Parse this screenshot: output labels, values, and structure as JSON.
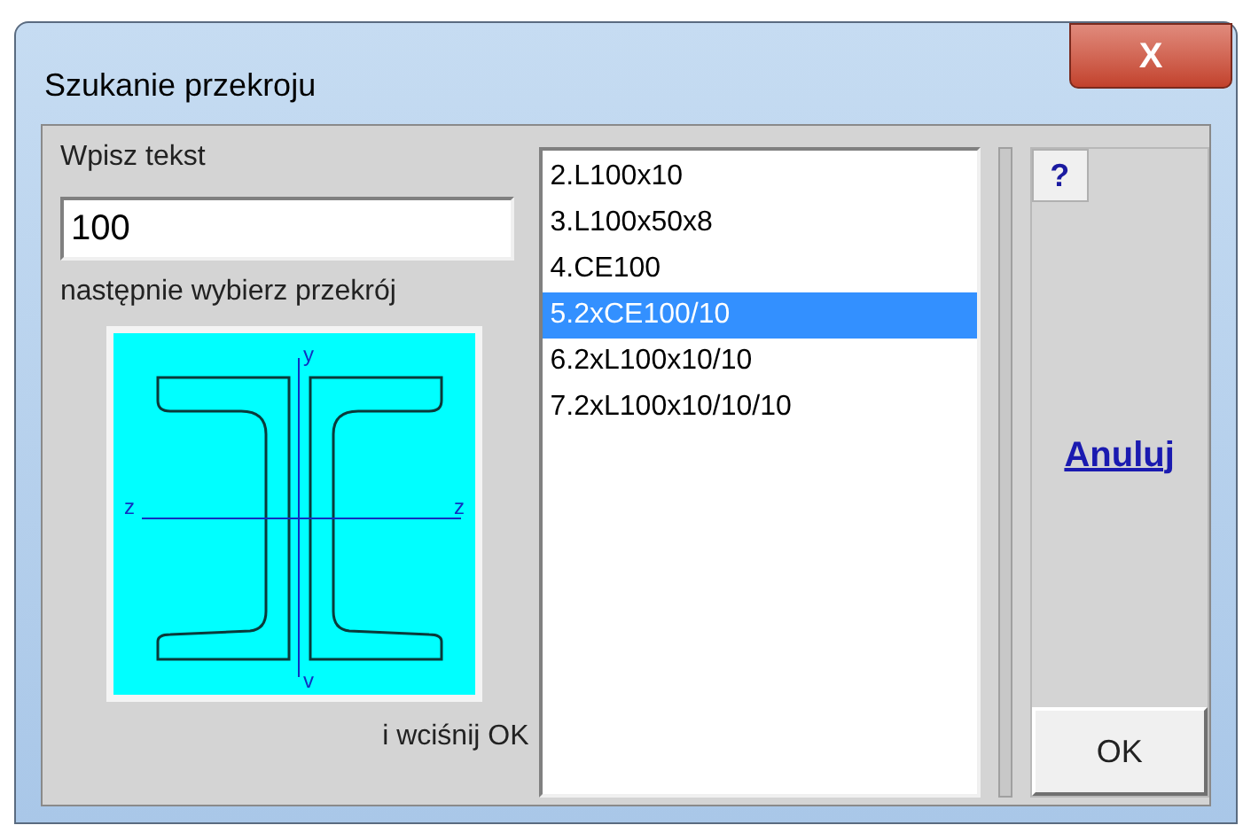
{
  "window": {
    "title": "Szukanie przekroju",
    "close_label": "X"
  },
  "search": {
    "label": "Wpisz tekst",
    "value": "100",
    "hint": "następnie wybierz przekrój"
  },
  "preview": {
    "axis_top": "y",
    "axis_bottom": "v",
    "axis_left": "z",
    "axis_right": "z"
  },
  "footer_hint": "i wciśnij OK",
  "sections": [
    {
      "label": "2.L100x10",
      "selected": false
    },
    {
      "label": "3.L100x50x8",
      "selected": false
    },
    {
      "label": "4.CE100",
      "selected": false
    },
    {
      "label": "5.2xCE100/10",
      "selected": true
    },
    {
      "label": "6.2xL100x10/10",
      "selected": false
    },
    {
      "label": "7.2xL100x10/10/10",
      "selected": false
    }
  ],
  "help_button": "?",
  "cancel_link": "Anuluj",
  "ok_button": "OK"
}
